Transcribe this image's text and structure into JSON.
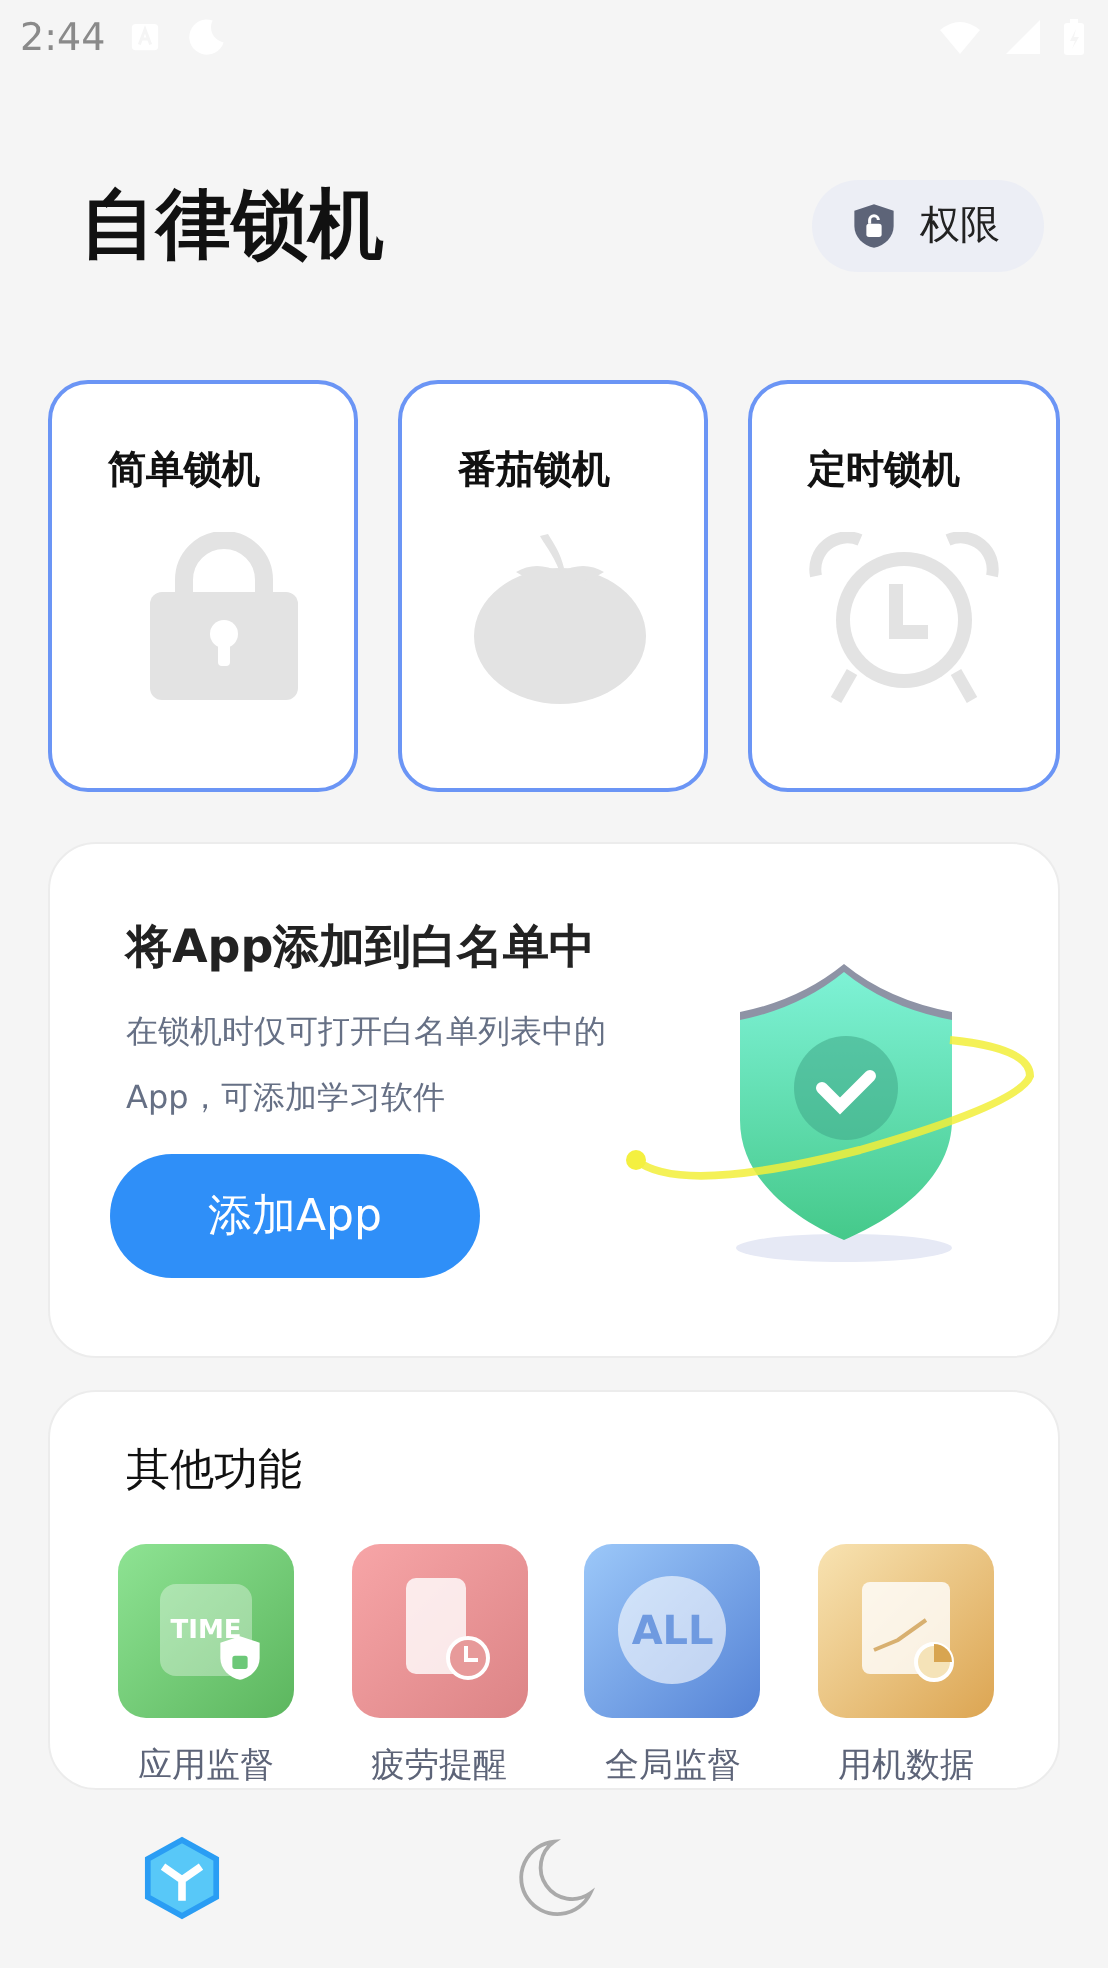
{
  "status_bar": {
    "time": "2:44"
  },
  "header": {
    "title": "自律锁机",
    "permission_button": "权限"
  },
  "lock_modes": [
    {
      "kind": "lock",
      "label": "简单锁机"
    },
    {
      "kind": "tomato",
      "label": "番茄锁机"
    },
    {
      "kind": "alarm",
      "label": "定时锁机"
    }
  ],
  "whitelist": {
    "title": "将App添加到白名单中",
    "description": "在锁机时仅可打开白名单列表中的App，可添加学习软件",
    "button": "添加App"
  },
  "other_features": {
    "title": "其他功能",
    "items": [
      {
        "kind": "time",
        "icon_text": "TIME",
        "label": "应用监督"
      },
      {
        "kind": "phone",
        "label": "疲劳提醒"
      },
      {
        "kind": "all",
        "icon_text": "ALL",
        "label": "全局监督"
      },
      {
        "kind": "chart",
        "label": "用机数据"
      }
    ]
  },
  "bottom_nav": [
    {
      "kind": "cube",
      "selected": true
    },
    {
      "kind": "moon",
      "selected": false
    }
  ]
}
